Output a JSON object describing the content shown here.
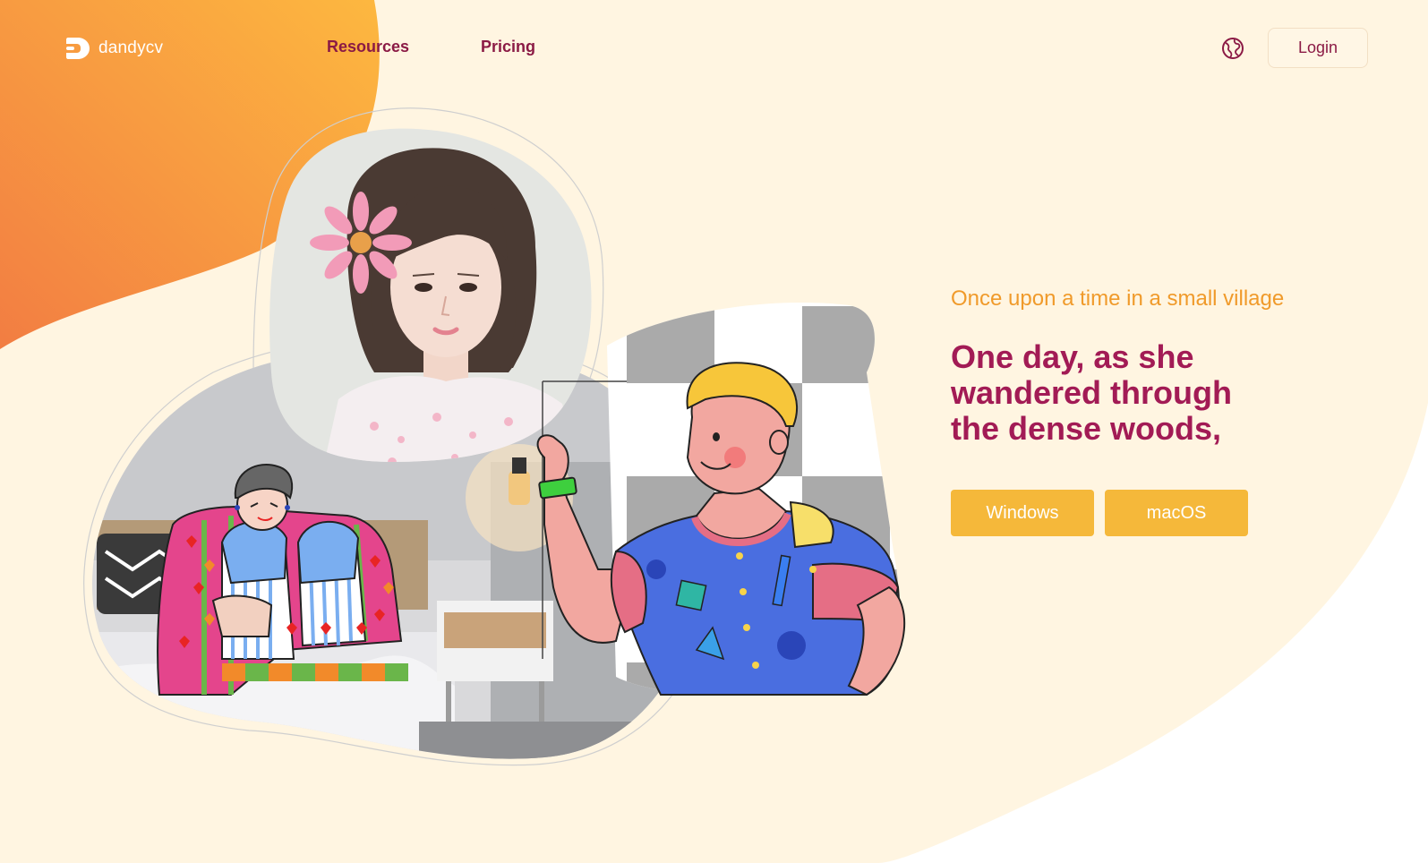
{
  "brand": {
    "name": "dandycv"
  },
  "nav": {
    "items": [
      {
        "label": "Resources"
      },
      {
        "label": "Pricing"
      }
    ]
  },
  "header": {
    "language_icon": "globe-icon",
    "login_label": "Login"
  },
  "hero": {
    "eyebrow": "Once upon a time in a small village",
    "headline": "One day, as she wandered through the dense woods,",
    "buttons": [
      {
        "label": "Windows"
      },
      {
        "label": "macOS"
      }
    ]
  },
  "colors": {
    "background_cream": "#fff5e1",
    "orange_gradient_start": "#f27d42",
    "orange_gradient_end": "#fdb840",
    "nav_text": "#8b1a45",
    "eyebrow": "#f09a2a",
    "headline": "#a21b55",
    "button": "#f5b83a"
  }
}
